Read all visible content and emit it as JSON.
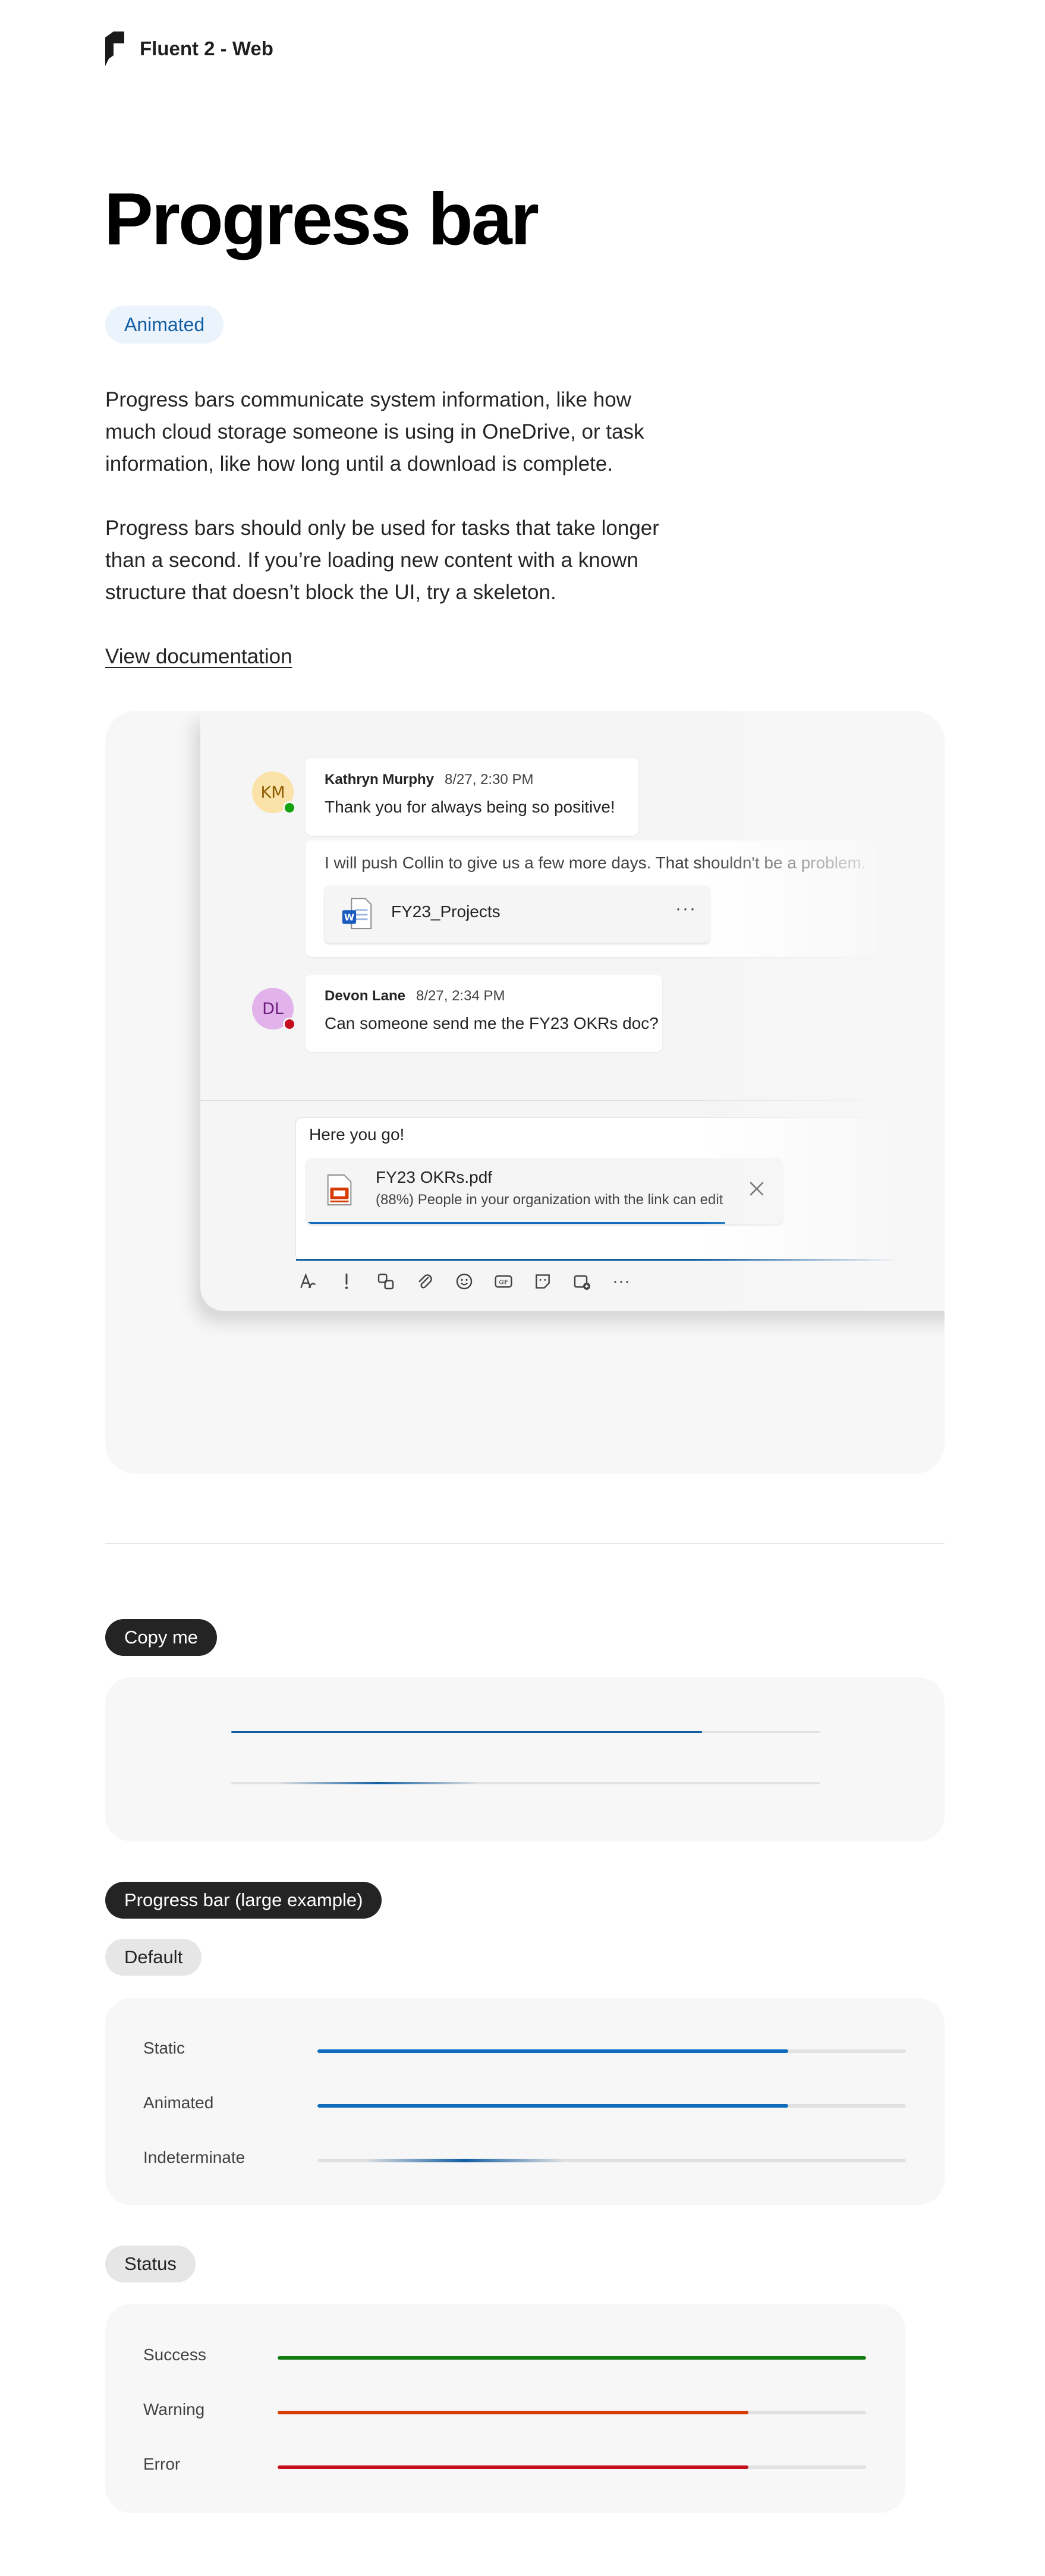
{
  "header": {
    "brand": "Fluent 2 - Web"
  },
  "title": "Progress bar",
  "badge": "Animated",
  "intro": [
    "Progress bars communicate system information, like how much cloud storage someone is using in OneDrive, or task information, like how long until a download is complete.",
    "Progress bars should only be used for tasks that take longer than a second. If you’re loading new content with a known structure that doesn’t block the UI, try a skeleton."
  ],
  "doc_link": "View documentation",
  "demo": {
    "messages": [
      {
        "initials": "KM",
        "name": "Kathryn Murphy",
        "time": "8/27, 2:30 PM",
        "text": "Thank you for always being so positive!",
        "avatar_bg": "#fbe2a8",
        "avatar_fg": "#8a5a00",
        "presence": "#13a10e"
      },
      {
        "text": "I will push Collin to give us a few more days. That shouldn't be a problem.",
        "file": "FY23_Projects",
        "file_menu": "···"
      },
      {
        "initials": "DL",
        "name": "Devon Lane",
        "time": "8/27, 2:34 PM",
        "text": "Can someone send me the FY23 OKRs doc?",
        "avatar_bg": "#e2b2ea",
        "avatar_fg": "#6b1d7b",
        "presence": "#c50f1f"
      }
    ],
    "composer": {
      "text": "Here you go!",
      "file_name": "FY23 OKRs.pdf",
      "file_status": "(88%) People in your organization with the link can edit",
      "progress": 0.88,
      "close_icon": "close-icon"
    },
    "toolbar_icons": [
      "format-icon",
      "important-icon",
      "loop-icon",
      "attach-icon",
      "emoji-icon",
      "gif-icon",
      "sticker-icon",
      "schedule-icon",
      "more-icon"
    ],
    "toolbar_more": "···"
  },
  "copy_me": {
    "label": "Copy me",
    "bars": [
      {
        "mode": "determinate",
        "value": 0.8
      },
      {
        "mode": "indeterminate"
      }
    ]
  },
  "large": {
    "heading": "Progress bar (large example)",
    "default": {
      "label": "Default",
      "rows": [
        {
          "label": "Static",
          "value": 0.8
        },
        {
          "label": "Animated",
          "value": 0.8
        },
        {
          "label": "Indeterminate",
          "value": null
        }
      ]
    },
    "status": {
      "label": "Status",
      "rows": [
        {
          "label": "Success",
          "value": 1.0,
          "color": "#107c10"
        },
        {
          "label": "Warning",
          "value": 0.8,
          "color": "#da3b01"
        },
        {
          "label": "Error",
          "value": 0.8,
          "color": "#c50f1f"
        }
      ]
    }
  },
  "colors": {
    "brand": "#0f6cbd",
    "brand_dark": "#115ea3",
    "track": "#e1e1e1"
  }
}
